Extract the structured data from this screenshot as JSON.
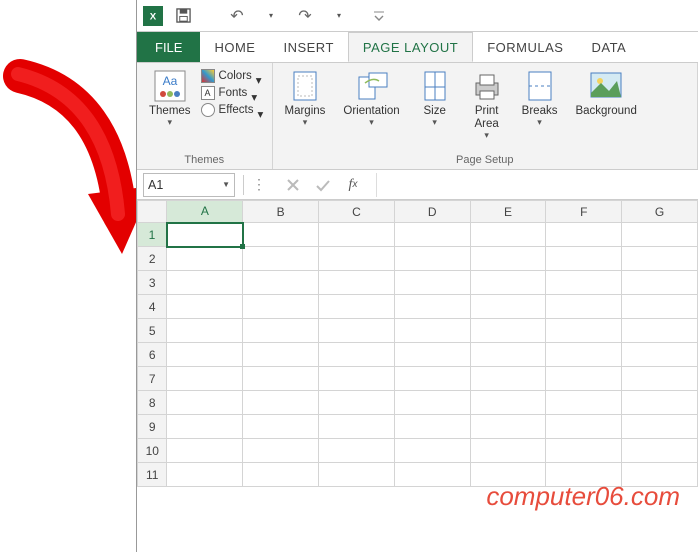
{
  "qat": {
    "undo": "↶",
    "redo": "↷"
  },
  "tabs": {
    "file": "FILE",
    "items": [
      "HOME",
      "INSERT",
      "PAGE LAYOUT",
      "FORMULAS",
      "DATA"
    ],
    "active_index": 2
  },
  "ribbon": {
    "themes": {
      "btn": "Themes",
      "colors": "Colors",
      "fonts": "Fonts",
      "effects": "Effects",
      "group_label": "Themes"
    },
    "page_setup": {
      "margins": "Margins",
      "orientation": "Orientation",
      "size": "Size",
      "print_area": "Print\nArea",
      "breaks": "Breaks",
      "background": "Background",
      "group_label": "Page Setup"
    }
  },
  "namebox": {
    "value": "A1"
  },
  "grid": {
    "columns": [
      "A",
      "B",
      "C",
      "D",
      "E",
      "F",
      "G"
    ],
    "rows": [
      1,
      2,
      3,
      4,
      5,
      6,
      7,
      8,
      9,
      10,
      11
    ],
    "selected_col": "A",
    "selected_row": 1
  },
  "watermark": "computer06.com"
}
